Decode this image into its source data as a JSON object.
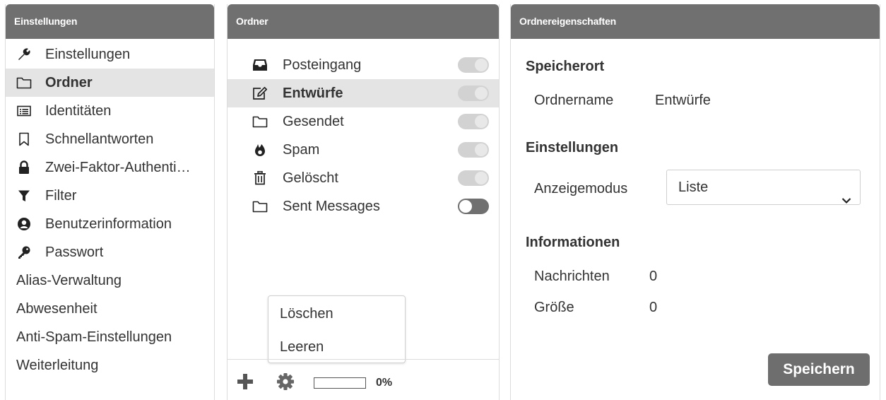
{
  "left_panel": {
    "title": "Einstellungen",
    "items": [
      {
        "label": "Einstellungen",
        "icon": "wrench-icon"
      },
      {
        "label": "Ordner",
        "icon": "folder-icon",
        "selected": true
      },
      {
        "label": "Identitäten",
        "icon": "id-card-icon"
      },
      {
        "label": "Schnellantworten",
        "icon": "bookmark-icon"
      },
      {
        "label": "Zwei-Faktor-Authenti…",
        "icon": "lock-icon"
      },
      {
        "label": "Filter",
        "icon": "filter-icon"
      },
      {
        "label": "Benutzerinformation",
        "icon": "user-circle-icon"
      },
      {
        "label": "Passwort",
        "icon": "key-icon"
      },
      {
        "label": "Alias-Verwaltung"
      },
      {
        "label": "Abwesenheit"
      },
      {
        "label": "Anti-Spam-Einstellungen"
      },
      {
        "label": "Weiterleitung"
      }
    ]
  },
  "middle_panel": {
    "title": "Ordner",
    "folders": [
      {
        "label": "Posteingang",
        "icon": "inbox-icon",
        "subscribed": true
      },
      {
        "label": "Entwürfe",
        "icon": "edit-icon",
        "subscribed": true,
        "selected": true
      },
      {
        "label": "Gesendet",
        "icon": "folder-icon",
        "subscribed": true
      },
      {
        "label": "Spam",
        "icon": "fire-icon",
        "subscribed": true
      },
      {
        "label": "Gelöscht",
        "icon": "trash-icon",
        "subscribed": true
      },
      {
        "label": "Sent Messages",
        "icon": "folder-icon",
        "subscribed": false
      }
    ],
    "context_menu": {
      "delete": "Löschen",
      "empty": "Leeren"
    },
    "footer": {
      "quota_percent": 0,
      "quota_text": "0%"
    }
  },
  "right_panel": {
    "title": "Ordnereigenschaften",
    "location_title": "Speicherort",
    "folder_name_label": "Ordnername",
    "folder_name_value": "Entwürfe",
    "settings_title": "Einstellungen",
    "display_mode_label": "Anzeigemodus",
    "display_mode_value": "Liste",
    "info_title": "Informationen",
    "messages_label": "Nachrichten",
    "messages_value": "0",
    "size_label": "Größe",
    "size_value": "0",
    "save_label": "Speichern"
  },
  "colors": {
    "header_bg": "#707070",
    "selected_bg": "#e4e4e4",
    "button_bg": "#6e6e6e",
    "text": "#333333"
  }
}
